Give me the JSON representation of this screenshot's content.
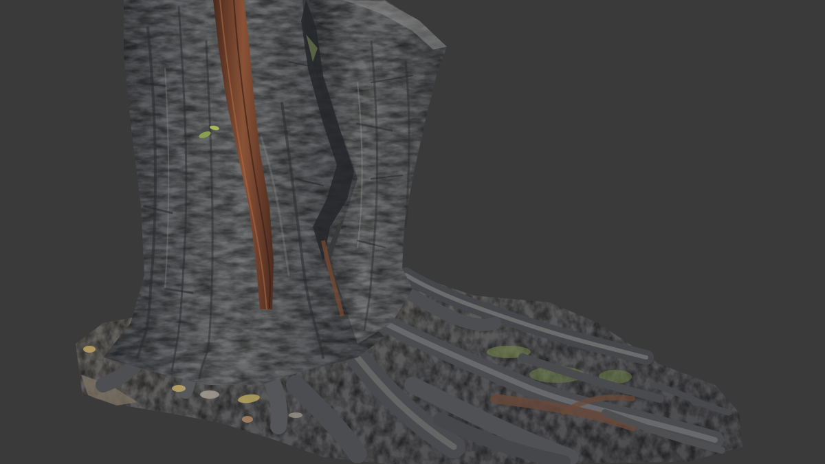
{
  "scene": {
    "subject": "tree-trunk-scan",
    "colors": {
      "background": "#3a3a3a",
      "bark_dark": "#2e2f31",
      "bark_mid": "#55575b",
      "bark_light": "#7b7d80",
      "bark_highlight": "#9a9a96",
      "vine_dark": "#4a2a1e",
      "vine_light": "#8a5236",
      "soil": "#6e6a62",
      "soil_light": "#9a958a",
      "moss": "#7a8a4a",
      "leaf": "#b8a45e"
    }
  }
}
